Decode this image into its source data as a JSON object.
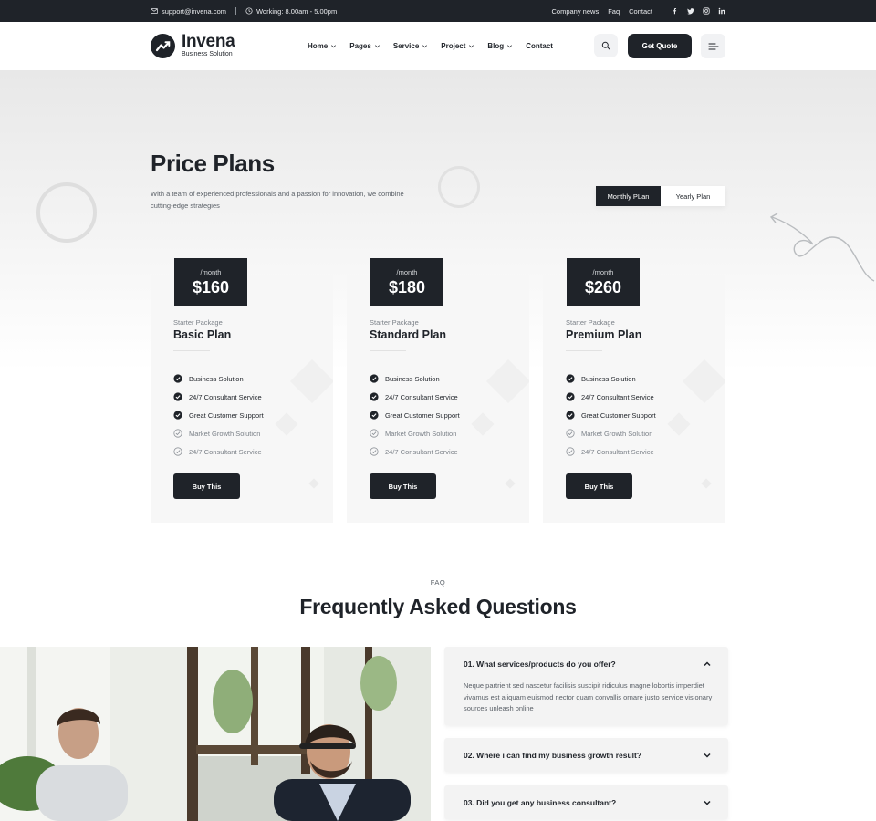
{
  "topbar": {
    "email": "support@invena.com",
    "hours": "Working: 8.00am - 5.00pm",
    "links": [
      "Company news",
      "Faq",
      "Contact"
    ],
    "social": [
      "facebook-icon",
      "twitter-icon",
      "instagram-icon",
      "linkedin-icon"
    ]
  },
  "header": {
    "logo_name": "Invena",
    "logo_tag": "Business Solution",
    "nav": [
      {
        "label": "Home",
        "dropdown": true
      },
      {
        "label": "Pages",
        "dropdown": true
      },
      {
        "label": "Service",
        "dropdown": true
      },
      {
        "label": "Project",
        "dropdown": true
      },
      {
        "label": "Blog",
        "dropdown": true
      },
      {
        "label": "Contact",
        "dropdown": false
      }
    ],
    "cta": "Get Quote"
  },
  "hero": {
    "title": "Price Plans",
    "description": "With a team of experienced professionals and a passion for innovation, we combine cutting-edge strategies",
    "toggle": [
      "Monthly PLan",
      "Yearly Plan"
    ],
    "toggle_active": "Monthly PLan"
  },
  "plans": [
    {
      "period": "/month",
      "price": "$160",
      "subtitle": "Starter Package",
      "name": "Basic Plan",
      "features": [
        {
          "text": "Business Solution",
          "included": true
        },
        {
          "text": "24/7 Consultant Service",
          "included": true
        },
        {
          "text": "Great Customer Support",
          "included": true
        },
        {
          "text": "Market Growth Solution",
          "included": false
        },
        {
          "text": "24/7 Consultant Service",
          "included": false
        }
      ],
      "button": "Buy This"
    },
    {
      "period": "/month",
      "price": "$180",
      "subtitle": "Starter Package",
      "name": "Standard Plan",
      "features": [
        {
          "text": "Business Solution",
          "included": true
        },
        {
          "text": "24/7 Consultant Service",
          "included": true
        },
        {
          "text": "Great Customer Support",
          "included": true
        },
        {
          "text": "Market Growth Solution",
          "included": false
        },
        {
          "text": "24/7 Consultant Service",
          "included": false
        }
      ],
      "button": "Buy This"
    },
    {
      "period": "/month",
      "price": "$260",
      "subtitle": "Starter Package",
      "name": "Premium Plan",
      "features": [
        {
          "text": "Business Solution",
          "included": true
        },
        {
          "text": "24/7 Consultant Service",
          "included": true
        },
        {
          "text": "Great Customer Support",
          "included": true
        },
        {
          "text": "Market Growth Solution",
          "included": false
        },
        {
          "text": "24/7 Consultant Service",
          "included": false
        }
      ],
      "button": "Buy This"
    }
  ],
  "faq": {
    "eyebrow": "FAQ",
    "title": "Frequently Asked Questions",
    "items": [
      {
        "question": "01. What services/products do you offer?",
        "answer": "Neque partrient sed nascetur facilisis suscipit ridiculus magne lobortis imperdiet vivamus est aliquam euismod nector quam convallis ornare justo service visionary sources unleash online",
        "open": true
      },
      {
        "question": "02. Where i can find my business growth result?",
        "answer": "",
        "open": false
      },
      {
        "question": "03. Did you get any business consultant?",
        "answer": "",
        "open": false
      }
    ]
  },
  "colors": {
    "dark": "#1f2329",
    "card_bg": "#f7f7f7",
    "muted_text": "#7b8188"
  }
}
